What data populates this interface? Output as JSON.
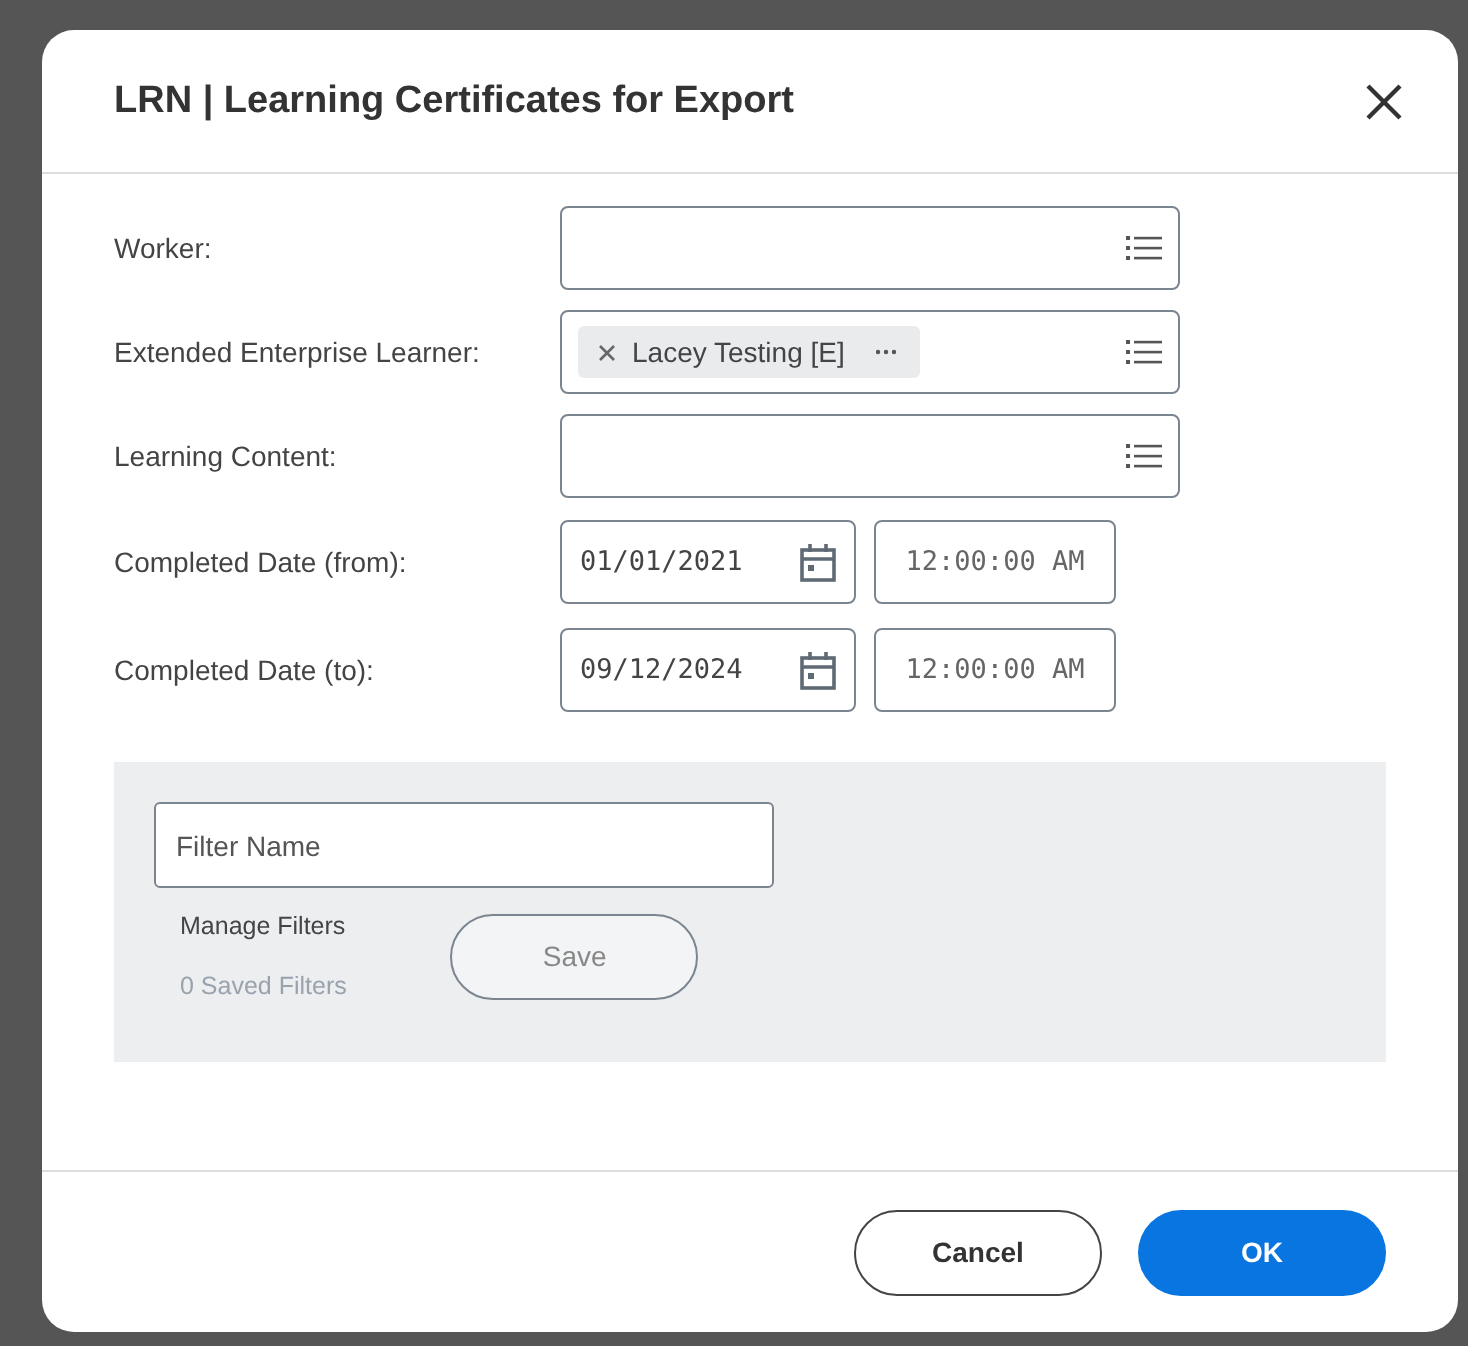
{
  "dialog": {
    "title": "LRN | Learning Certificates for Export"
  },
  "fields": [
    {
      "kind": "prompt",
      "label": "Worker:"
    },
    {
      "kind": "prompt",
      "label": "Extended Enterprise Learner:",
      "chips": [
        "Lacey Testing [E]"
      ]
    },
    {
      "kind": "prompt",
      "label": "Learning Content:"
    },
    {
      "kind": "datetime",
      "label": "Completed Date (from):",
      "date": "01/01/2021",
      "time": "12:00:00 AM"
    },
    {
      "kind": "datetime",
      "label": "Completed Date (to):",
      "date": "09/12/2024",
      "time": "12:00:00 AM"
    }
  ],
  "filters": {
    "placeholder": "Filter Name",
    "manage_label": "Manage Filters",
    "saved_count": "0 Saved Filters",
    "save_button": {
      "label": "Save",
      "disabled": true
    }
  },
  "buttons": [
    {
      "label": "Cancel",
      "kind": "secondary"
    },
    {
      "label": "OK",
      "kind": "primary"
    }
  ]
}
